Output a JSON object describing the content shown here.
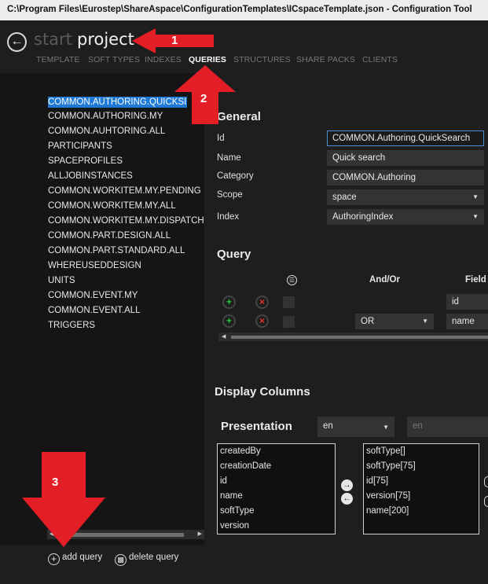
{
  "window": {
    "title": "C:\\Program Files\\Eurostep\\ShareAspace\\ConfigurationTemplates\\ICspaceTemplate.json - Configuration Tool"
  },
  "breadcrumb": {
    "start": "start",
    "project": "project"
  },
  "tabs": [
    {
      "label": "TEMPLATE",
      "active": false
    },
    {
      "label": "SOFT TYPES",
      "active": false
    },
    {
      "label": "INDEXES",
      "active": false
    },
    {
      "label": "QUERIES",
      "active": true
    },
    {
      "label": "STRUCTURES",
      "active": false
    },
    {
      "label": "SHARE PACKS",
      "active": false
    },
    {
      "label": "CLIENTS",
      "active": false
    }
  ],
  "queries": [
    "COMMON.AUTHORING.QUICKSI",
    "COMMON.AUTHORING.MY",
    "COMMON.AUHTORING.ALL",
    "PARTICIPANTS",
    "SPACEPROFILES",
    "ALLJOBINSTANCES",
    "COMMON.WORKITEM.MY.PENDING",
    "COMMON.WORKITEM.MY.ALL",
    "COMMON.WORKITEM.MY.DISPATCH",
    "COMMON.PART.DESIGN.ALL",
    "COMMON.PART.STANDARD.ALL",
    "WHEREUSEDDESIGN",
    "UNITS",
    "COMMON.EVENT.MY",
    "COMMON.EVENT.ALL",
    "TRIGGERS"
  ],
  "general": {
    "heading": "General",
    "id_label": "Id",
    "id_value": "COMMON.Authoring.QuickSearch",
    "name_label": "Name",
    "name_value": "Quick search",
    "category_label": "Category",
    "category_value": "COMMON.Authoring",
    "scope_label": "Scope",
    "scope_value": "space",
    "index_label": "Index",
    "index_value": "AuthoringIndex"
  },
  "query": {
    "heading": "Query",
    "col_andor": "And/Or",
    "col_field": "Field",
    "rows": [
      {
        "andor": "",
        "field": "id"
      },
      {
        "andor": "OR",
        "field": "name"
      }
    ]
  },
  "display_columns": {
    "heading": "Display Columns",
    "presentation_label": "Presentation",
    "lang_value": "en",
    "lang_placeholder": "en",
    "available": [
      "createdBy",
      "creationDate",
      "id",
      "name",
      "softType",
      "version"
    ],
    "selected": [
      "softType[]",
      "softType[75]",
      "id[75]",
      "version[75]",
      "name[200]"
    ]
  },
  "actions": {
    "add_query": "add query",
    "delete_query": "delete query"
  },
  "annotations": {
    "badge1": "1",
    "badge2": "2",
    "badge3": "3"
  },
  "colors": {
    "accent": "#1e7ad6",
    "arrow_red": "#e41e26",
    "add_green": "#27c53b",
    "delete_red": "#e23535"
  }
}
